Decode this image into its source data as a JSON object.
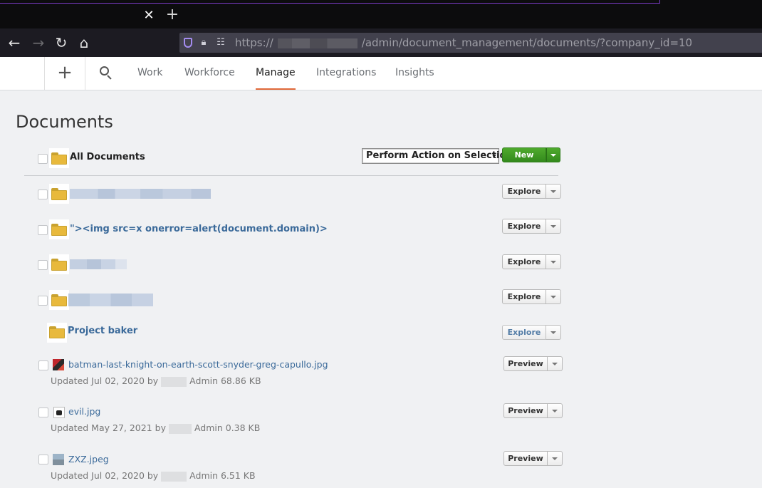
{
  "browser": {
    "url_prefix": "https://",
    "url_path": "/admin/document_management/documents/?company_id=10"
  },
  "appnav": {
    "tabs": [
      {
        "label": "Work",
        "active": false
      },
      {
        "label": "Workforce",
        "active": false
      },
      {
        "label": "Manage",
        "active": true
      },
      {
        "label": "Integrations",
        "active": false
      },
      {
        "label": "Insights",
        "active": false
      }
    ]
  },
  "page": {
    "title": "Documents",
    "all_documents_label": "All Documents",
    "action_select_value": "Perform Action on Selection",
    "new_button_label": "New"
  },
  "folders": [
    {
      "name": "",
      "button": "Explore"
    },
    {
      "name": "\"><img src=x onerror=alert(document.domain)>",
      "button": "Explore"
    },
    {
      "name": "",
      "button": "Explore"
    },
    {
      "name": "",
      "button": "Explore"
    },
    {
      "name": "Project baker",
      "button": "Explore"
    }
  ],
  "files": [
    {
      "name": "batman-last-knight-on-earth-scott-snyder-greg-capullo.jpg",
      "updated_prefix": "Updated Jul 02, 2020 by",
      "updated_suffix": "Admin 68.86 KB",
      "button": "Preview"
    },
    {
      "name": "evil.jpg",
      "updated_prefix": "Updated May 27, 2021 by",
      "updated_suffix": "Admin 0.38 KB",
      "button": "Preview"
    },
    {
      "name": "ZXZ.jpeg",
      "updated_prefix": "Updated Jul 02, 2020 by",
      "updated_suffix": "Admin 6.51 KB",
      "button": "Preview"
    }
  ],
  "colors": {
    "link": "#3b6a9a",
    "active_tab_underline": "#e1693a",
    "new_button": "#3f9a25"
  }
}
